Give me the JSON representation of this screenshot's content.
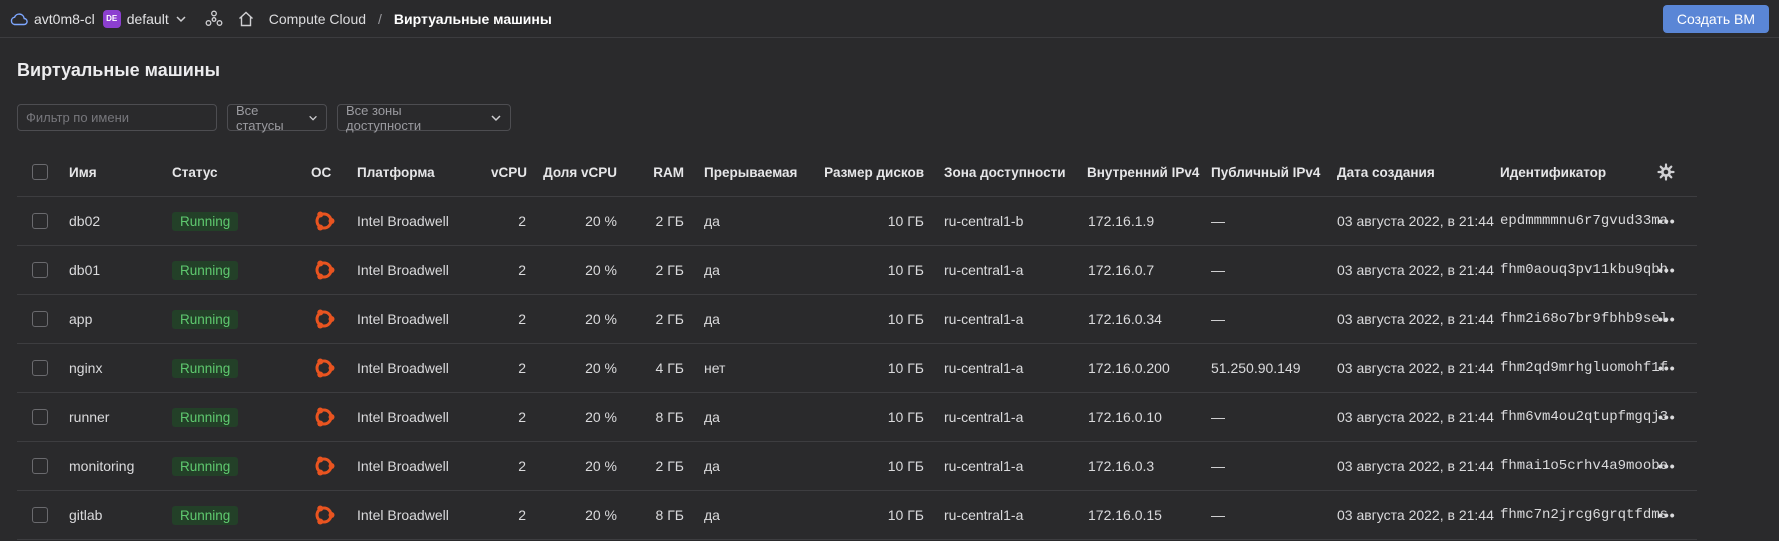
{
  "topbar": {
    "account": "avt0m8-cl",
    "folder_badge": "DE",
    "folder": "default",
    "breadcrumb_service": "Compute Cloud",
    "breadcrumb_separator": "/",
    "breadcrumb_current": "Виртуальные машины",
    "create_button": "Создать ВМ"
  },
  "page": {
    "title": "Виртуальные машины",
    "filter_placeholder": "Фильтр по имени",
    "status_select": "Все статусы",
    "zone_select": "Все зоны доступности"
  },
  "table": {
    "headers": {
      "name": "Имя",
      "status": "Статус",
      "os": "ОС",
      "platform": "Платформа",
      "vcpu": "vCPU",
      "vcpu_share": "Доля vCPU",
      "ram": "RAM",
      "preemptible": "Прерываемая",
      "disk_size": "Размер дисков",
      "zone": "Зона доступности",
      "internal_ip": "Внутренний IPv4",
      "public_ip": "Публичный IPv4",
      "created": "Дата создания",
      "id": "Идентификатор"
    },
    "rows": [
      {
        "name": "db02",
        "status": "Running",
        "platform": "Intel Broadwell",
        "vcpu": "2",
        "vcpu_share": "20 %",
        "ram": "2 ГБ",
        "preemptible": "да",
        "disk_size": "10 ГБ",
        "zone": "ru-central1-b",
        "internal_ip": "172.16.1.9",
        "public_ip": "—",
        "created": "03 августа 2022, в 21:44",
        "id": "epdmmmmnu6r7gvud33ma"
      },
      {
        "name": "db01",
        "status": "Running",
        "platform": "Intel Broadwell",
        "vcpu": "2",
        "vcpu_share": "20 %",
        "ram": "2 ГБ",
        "preemptible": "да",
        "disk_size": "10 ГБ",
        "zone": "ru-central1-a",
        "internal_ip": "172.16.0.7",
        "public_ip": "—",
        "created": "03 августа 2022, в 21:44",
        "id": "fhm0aouq3pv11kbu9qbh"
      },
      {
        "name": "app",
        "status": "Running",
        "platform": "Intel Broadwell",
        "vcpu": "2",
        "vcpu_share": "20 %",
        "ram": "2 ГБ",
        "preemptible": "да",
        "disk_size": "10 ГБ",
        "zone": "ru-central1-a",
        "internal_ip": "172.16.0.34",
        "public_ip": "—",
        "created": "03 августа 2022, в 21:44",
        "id": "fhm2i68o7br9fbhb9sel"
      },
      {
        "name": "nginx",
        "status": "Running",
        "platform": "Intel Broadwell",
        "vcpu": "2",
        "vcpu_share": "20 %",
        "ram": "4 ГБ",
        "preemptible": "нет",
        "disk_size": "10 ГБ",
        "zone": "ru-central1-a",
        "internal_ip": "172.16.0.200",
        "public_ip": "51.250.90.149",
        "created": "03 августа 2022, в 21:44",
        "id": "fhm2qd9mrhgluomohf1f"
      },
      {
        "name": "runner",
        "status": "Running",
        "platform": "Intel Broadwell",
        "vcpu": "2",
        "vcpu_share": "20 %",
        "ram": "8 ГБ",
        "preemptible": "да",
        "disk_size": "10 ГБ",
        "zone": "ru-central1-a",
        "internal_ip": "172.16.0.10",
        "public_ip": "—",
        "created": "03 августа 2022, в 21:44",
        "id": "fhm6vm4ou2qtupfmgqj3"
      },
      {
        "name": "monitoring",
        "status": "Running",
        "platform": "Intel Broadwell",
        "vcpu": "2",
        "vcpu_share": "20 %",
        "ram": "2 ГБ",
        "preemptible": "да",
        "disk_size": "10 ГБ",
        "zone": "ru-central1-a",
        "internal_ip": "172.16.0.3",
        "public_ip": "—",
        "created": "03 августа 2022, в 21:44",
        "id": "fhmai1o5crhv4a9moobe"
      },
      {
        "name": "gitlab",
        "status": "Running",
        "platform": "Intel Broadwell",
        "vcpu": "2",
        "vcpu_share": "20 %",
        "ram": "8 ГБ",
        "preemptible": "да",
        "disk_size": "10 ГБ",
        "zone": "ru-central1-a",
        "internal_ip": "172.16.0.15",
        "public_ip": "—",
        "created": "03 августа 2022, в 21:44",
        "id": "fhmc7n2jrcg6grqtfdms"
      }
    ]
  },
  "icons": {
    "cloud": "cloud-icon",
    "services": "services-icon",
    "home": "home-icon",
    "os": "ubuntu-icon",
    "settings": "gear-icon",
    "more": "more-icon"
  },
  "colors": {
    "accent": "#5a86d6",
    "status_running": "#5fc96f",
    "ubuntu": "#e95420",
    "folder_badge": "#8c3fd0"
  }
}
